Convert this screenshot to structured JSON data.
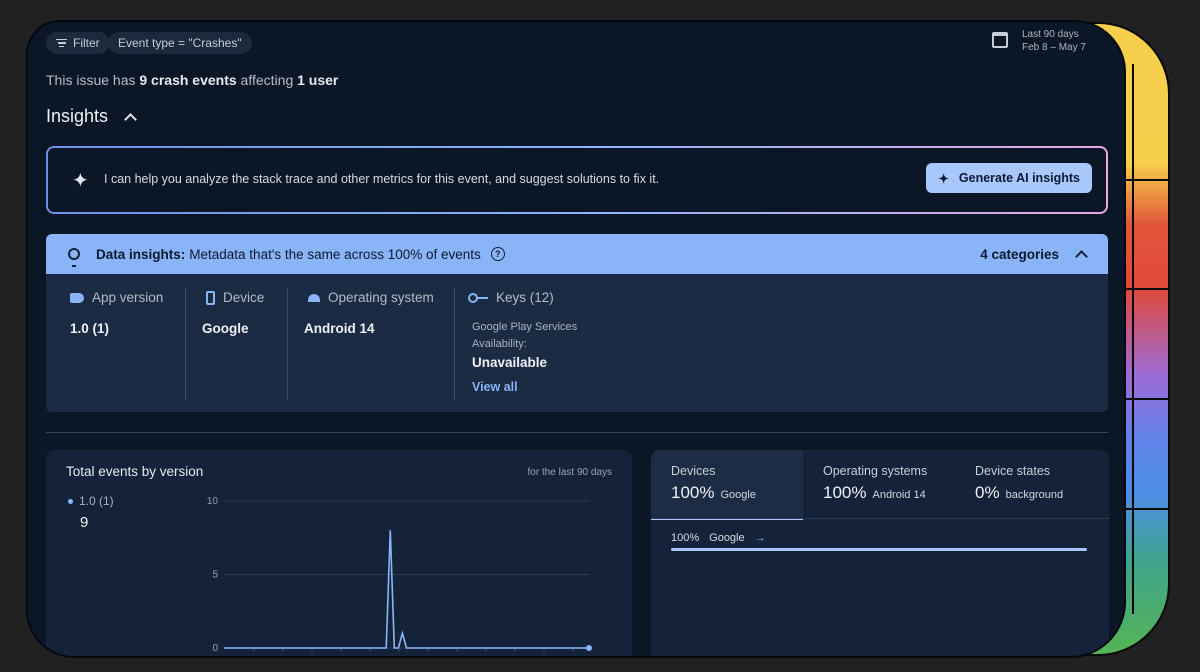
{
  "filters": {
    "filter_label": "Filter",
    "event_type_chip": "Event type = \"Crashes\""
  },
  "date_range": {
    "label": "Last 90 days",
    "range": "Feb 8 – May 7"
  },
  "summary": {
    "prefix": "This issue has ",
    "events": "9 crash events",
    "middle": " affecting ",
    "users": "1 user"
  },
  "insights": {
    "title": "Insights",
    "ai_prompt": "I can help you analyze the stack trace and other metrics for this event, and suggest solutions to fix it.",
    "generate_button": "Generate AI insights"
  },
  "data_insights": {
    "title_bold": "Data insights:",
    "title_rest": " Metadata that's the same across 100% of events",
    "categories": "4 categories",
    "columns": [
      {
        "label": "App version",
        "value": "1.0 (1)",
        "icon": "tag-icon"
      },
      {
        "label": "Device",
        "value": "Google",
        "icon": "phone-icon"
      },
      {
        "label": "Operating system",
        "value": "Android 14",
        "icon": "android-icon"
      },
      {
        "label": "Keys (12)",
        "icon": "key-icon",
        "key_name_1": "Google Play Services",
        "key_name_2": "Availability:",
        "value": "Unavailable",
        "link": "View all"
      }
    ]
  },
  "events_card": {
    "title": "Total events by version",
    "period": "for the last 90 days",
    "legend_version": "1.0 (1)",
    "legend_count": "9"
  },
  "chart_data": {
    "type": "line",
    "series": [
      {
        "name": "1.0 (1)",
        "points": [
          [
            0,
            0
          ],
          [
            40,
            0
          ],
          [
            41,
            8
          ],
          [
            42,
            0
          ],
          [
            43,
            0
          ],
          [
            44,
            1
          ],
          [
            45,
            0
          ],
          [
            90,
            0
          ]
        ]
      }
    ],
    "xlim": [
      0,
      90
    ],
    "ylim": [
      0,
      10
    ],
    "yticks": [
      "0",
      "5",
      "10"
    ],
    "grid": true,
    "color": "#8ab4f8"
  },
  "breakdown": {
    "tabs": [
      {
        "title": "Devices",
        "value": "100%",
        "sub": "Google"
      },
      {
        "title": "Operating systems",
        "value": "100%",
        "sub": "Android 14"
      },
      {
        "title": "Device states",
        "value": "0%",
        "sub": "background"
      }
    ],
    "row_pct": "100%",
    "row_label": "Google",
    "row_fraction": 1.0
  }
}
